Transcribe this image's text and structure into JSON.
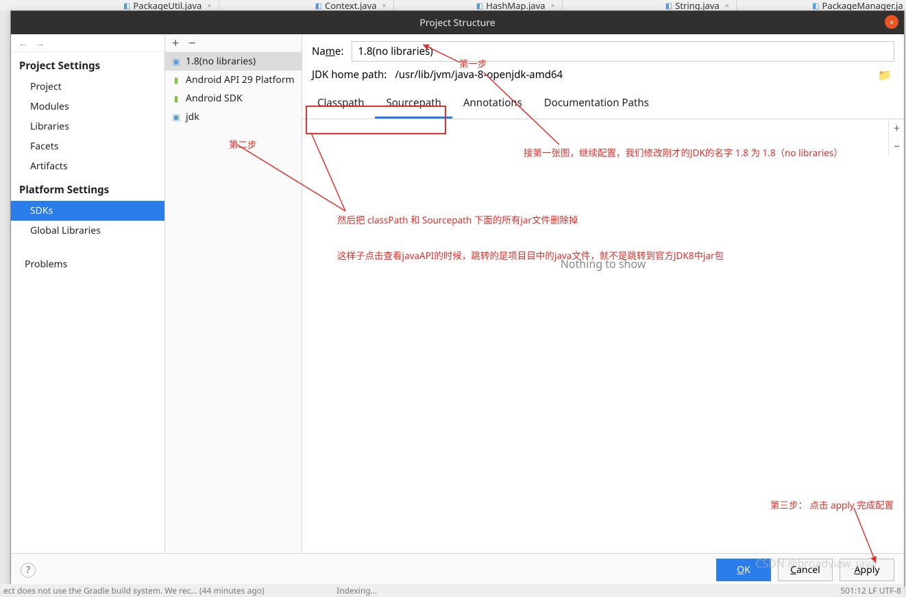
{
  "bg_tabs": [
    "PackageUtil.java",
    "Context.java",
    "HashMap.java",
    "String.java",
    "PackageManager.ja"
  ],
  "dialog": {
    "title": "Project Structure",
    "close": "×"
  },
  "nav": {
    "back": "←",
    "fwd": "→",
    "section1": "Project Settings",
    "items1": [
      "Project",
      "Modules",
      "Libraries",
      "Facets",
      "Artifacts"
    ],
    "section2": "Platform Settings",
    "items2": [
      "SDKs",
      "Global Libraries"
    ],
    "problems": "Problems"
  },
  "mid": {
    "add": "+",
    "remove": "−",
    "items": [
      {
        "icon": "folder",
        "label": "1.8(no libraries)",
        "sel": true
      },
      {
        "icon": "android",
        "label": "Android API 29 Platform"
      },
      {
        "icon": "android",
        "label": "Android SDK"
      },
      {
        "icon": "folder",
        "label": "jdk"
      }
    ]
  },
  "form": {
    "name_label_pre": "Na",
    "name_label_u": "m",
    "name_label_post": "e:",
    "name_value": "1.8(no libraries)",
    "path_label": "JDK home path:",
    "path_value": "/usr/lib/jvm/java-8-openjdk-amd64",
    "browse": "📁"
  },
  "tabs": {
    "items": [
      "Classpath",
      "Sourcepath",
      "Annotations",
      "Documentation Paths"
    ],
    "active": 1,
    "nothing": "Nothing to show",
    "plus": "+",
    "minus": "−"
  },
  "footer": {
    "help": "?",
    "ok_u": "O",
    "ok_rest": "K",
    "cancel_u": "C",
    "cancel_rest": "ancel",
    "apply_u": "A",
    "apply_rest": "pply"
  },
  "anno": {
    "step1": "第一步",
    "step2": "第二步",
    "step3": "第三步： 点击 apply 完成配置",
    "line1": "接第一张图，继续配置，我们修改刚才的JDK的名字 1.8 为 1.8（no libraries）",
    "line2": "然后把 classPath 和 Sourcepath 下面的所有jar文件删除掉",
    "line3": "这样子点击查看javaAPI的时候，跳转的是项目目中的java文件，就不是跳转到官方JDK8中jar包"
  },
  "ghost": {
    "left": "ect does not use the Gradle build system. We rec… (44 minutes ago)",
    "mid": "Indexing…",
    "right": "501:12  LF  UTF-8"
  },
  "watermark": "CSDN @broadview_java"
}
